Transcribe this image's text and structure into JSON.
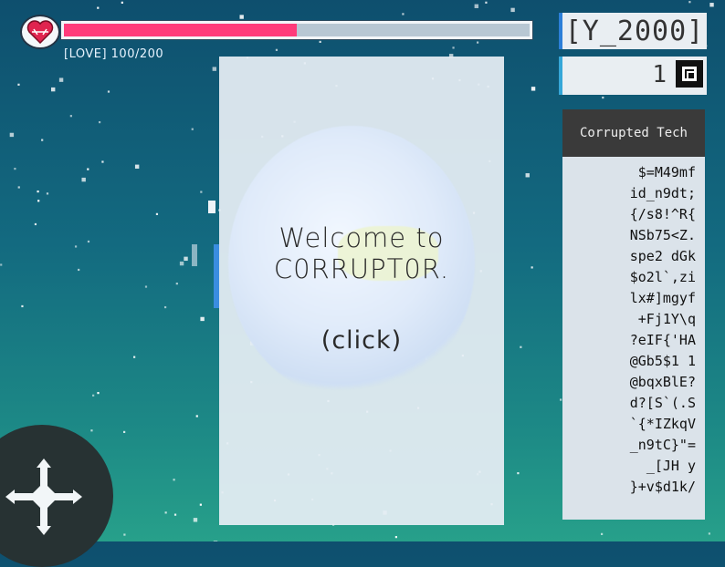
{
  "love": {
    "label": "[LOVE] 100/200",
    "current": 100,
    "max": 200,
    "color": "#ff3b7a"
  },
  "year": "[Y_2000]",
  "cubes": {
    "count": "1"
  },
  "tech": {
    "title": "Corrupted Tech",
    "lines": [
      "$=M49mf",
      "id_n9dt;",
      "{/s8!^R{",
      "NSb75<Z.",
      "spe2 dGk",
      "$o2l`,zi",
      "lx#]mgyf",
      "+Fj1Y\\q",
      "?eIF{'HA",
      "@Gb5$1 1",
      "@bqxBlE?",
      "d?[S`(.S",
      "`{*IZkqV",
      "_n9tC}\"=",
      "_[JH y",
      "}+v$d1k/"
    ]
  },
  "main": {
    "welcome": "Welcome to C0RRUPT0R.",
    "click": "(click)"
  },
  "icons": {
    "heart": "heart-icon",
    "cube": "cube-icon",
    "dpad": "dpad-icon"
  },
  "colors": {
    "accent": "#2c7fd8",
    "love_fill": "#ff3b7a"
  }
}
